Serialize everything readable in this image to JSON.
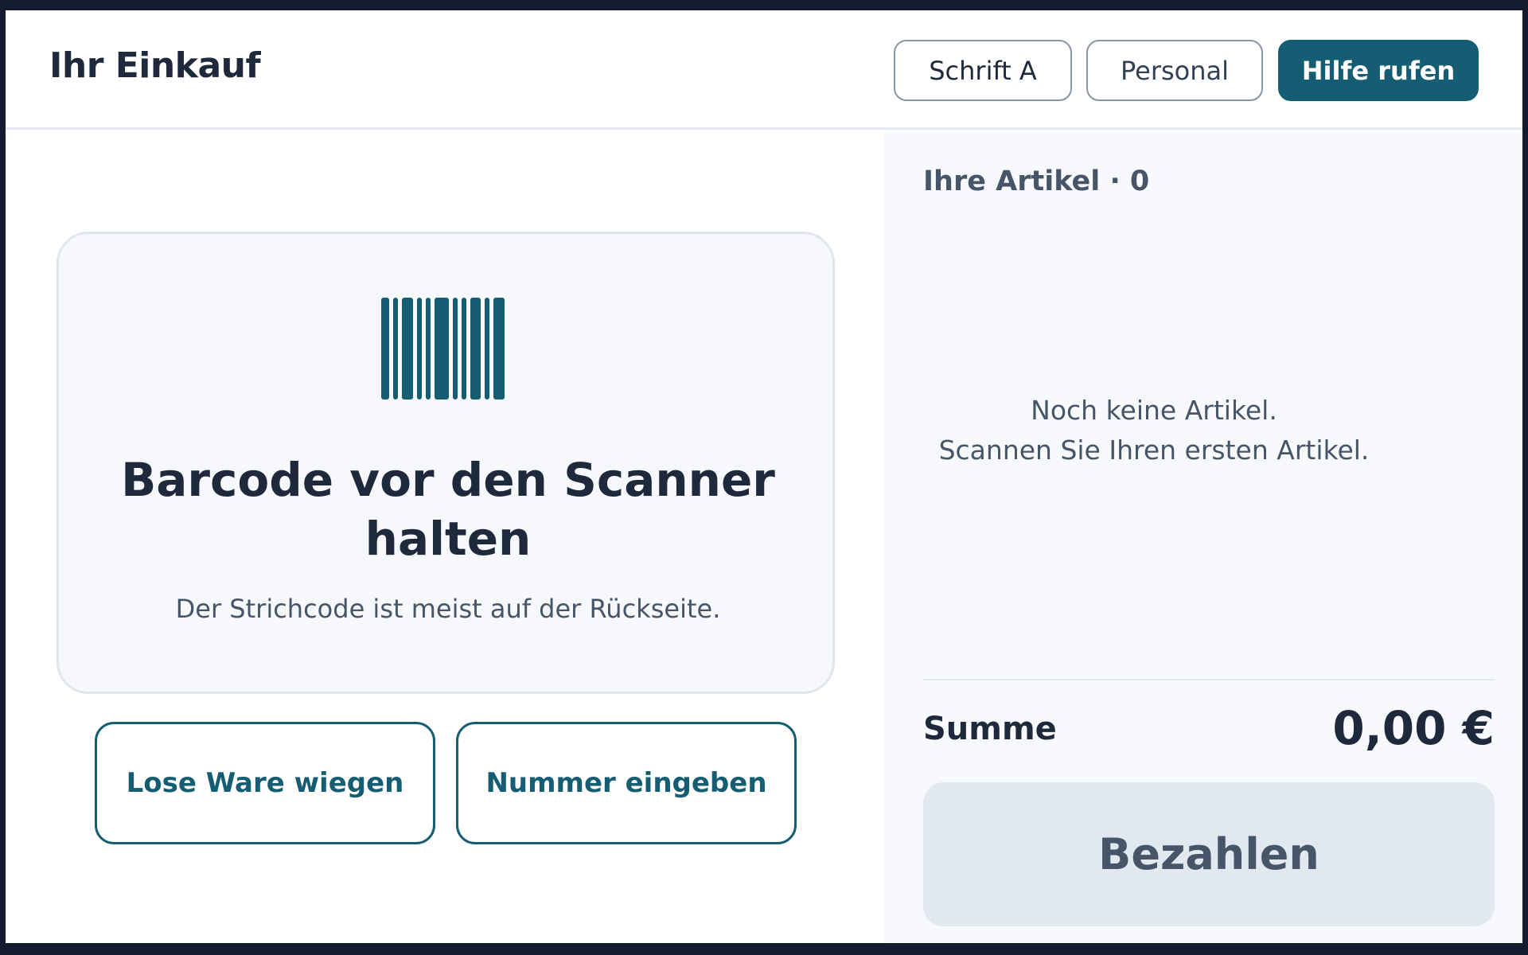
{
  "header": {
    "title": "Ihr Einkauf",
    "font_button": "Schrift A",
    "staff_button": "Personal",
    "help_button": "Hilfe rufen"
  },
  "scan": {
    "icon": "barcode-icon",
    "title": "Barcode vor den Scanner halten",
    "hint": "Der Strichcode ist meist auf der Rückseite."
  },
  "actions": {
    "weigh": "Lose Ware wiegen",
    "enter_number": "Nummer eingeben"
  },
  "cart": {
    "heading": "Ihre Artikel · 0",
    "empty_line1": "Noch keine Artikel.",
    "empty_line2": "Scannen Sie Ihren ersten Artikel.",
    "sum_label": "Summe",
    "sum_value": "0,00 €",
    "pay_button": "Bezahlen"
  },
  "colors": {
    "accent": "#145d72",
    "text": "#1e293b",
    "muted": "#475569",
    "disabled": "#e2e8f0"
  }
}
